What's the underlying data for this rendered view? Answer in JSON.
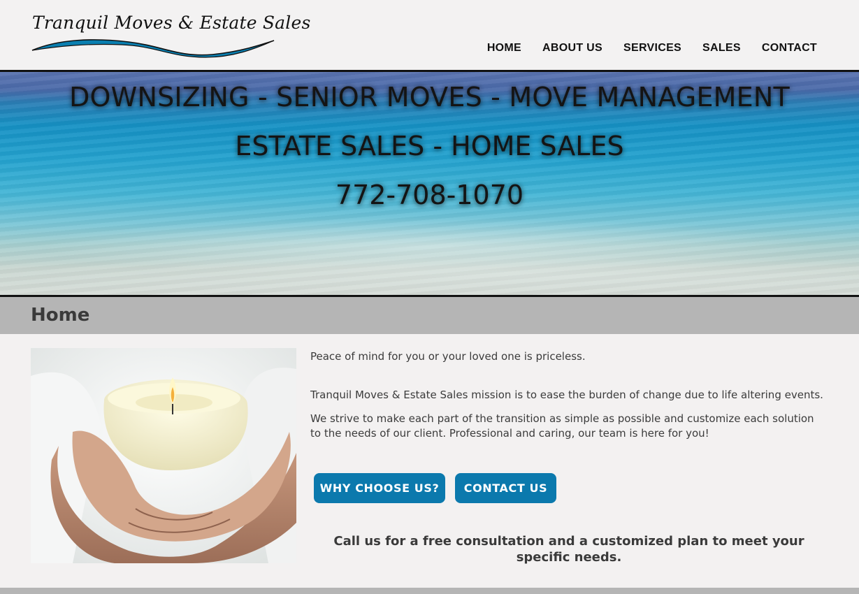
{
  "header": {
    "logo_text": "Tranquil Moves & Estate Sales",
    "nav": [
      "HOME",
      "ABOUT US",
      "SERVICES",
      "SALES",
      "CONTACT"
    ]
  },
  "hero": {
    "line1": "DOWNSIZING - SENIOR MOVES - MOVE MANAGEMENT",
    "line2": "ESTATE SALES - HOME SALES",
    "line3": "772-708-1070"
  },
  "page": {
    "title": "Home"
  },
  "content": {
    "p1": "Peace of mind for you or your loved one is priceless.",
    "p2": "Tranquil Moves & Estate Sales mission is to ease the burden of change due to life altering events.",
    "p3": "We strive to make each part of the transition as simple as possible and customize each solution to the needs of our client. Professional and caring, our team is here for you!",
    "buttons": {
      "why": "WHY CHOOSE US?",
      "contact": "CONTACT US"
    },
    "cta": "Call us for a free consultation and a customized plan to meet your specific needs."
  },
  "colors": {
    "accent": "#0b79ad",
    "band": "#b5b5b5",
    "background": "#f3f1f1"
  }
}
